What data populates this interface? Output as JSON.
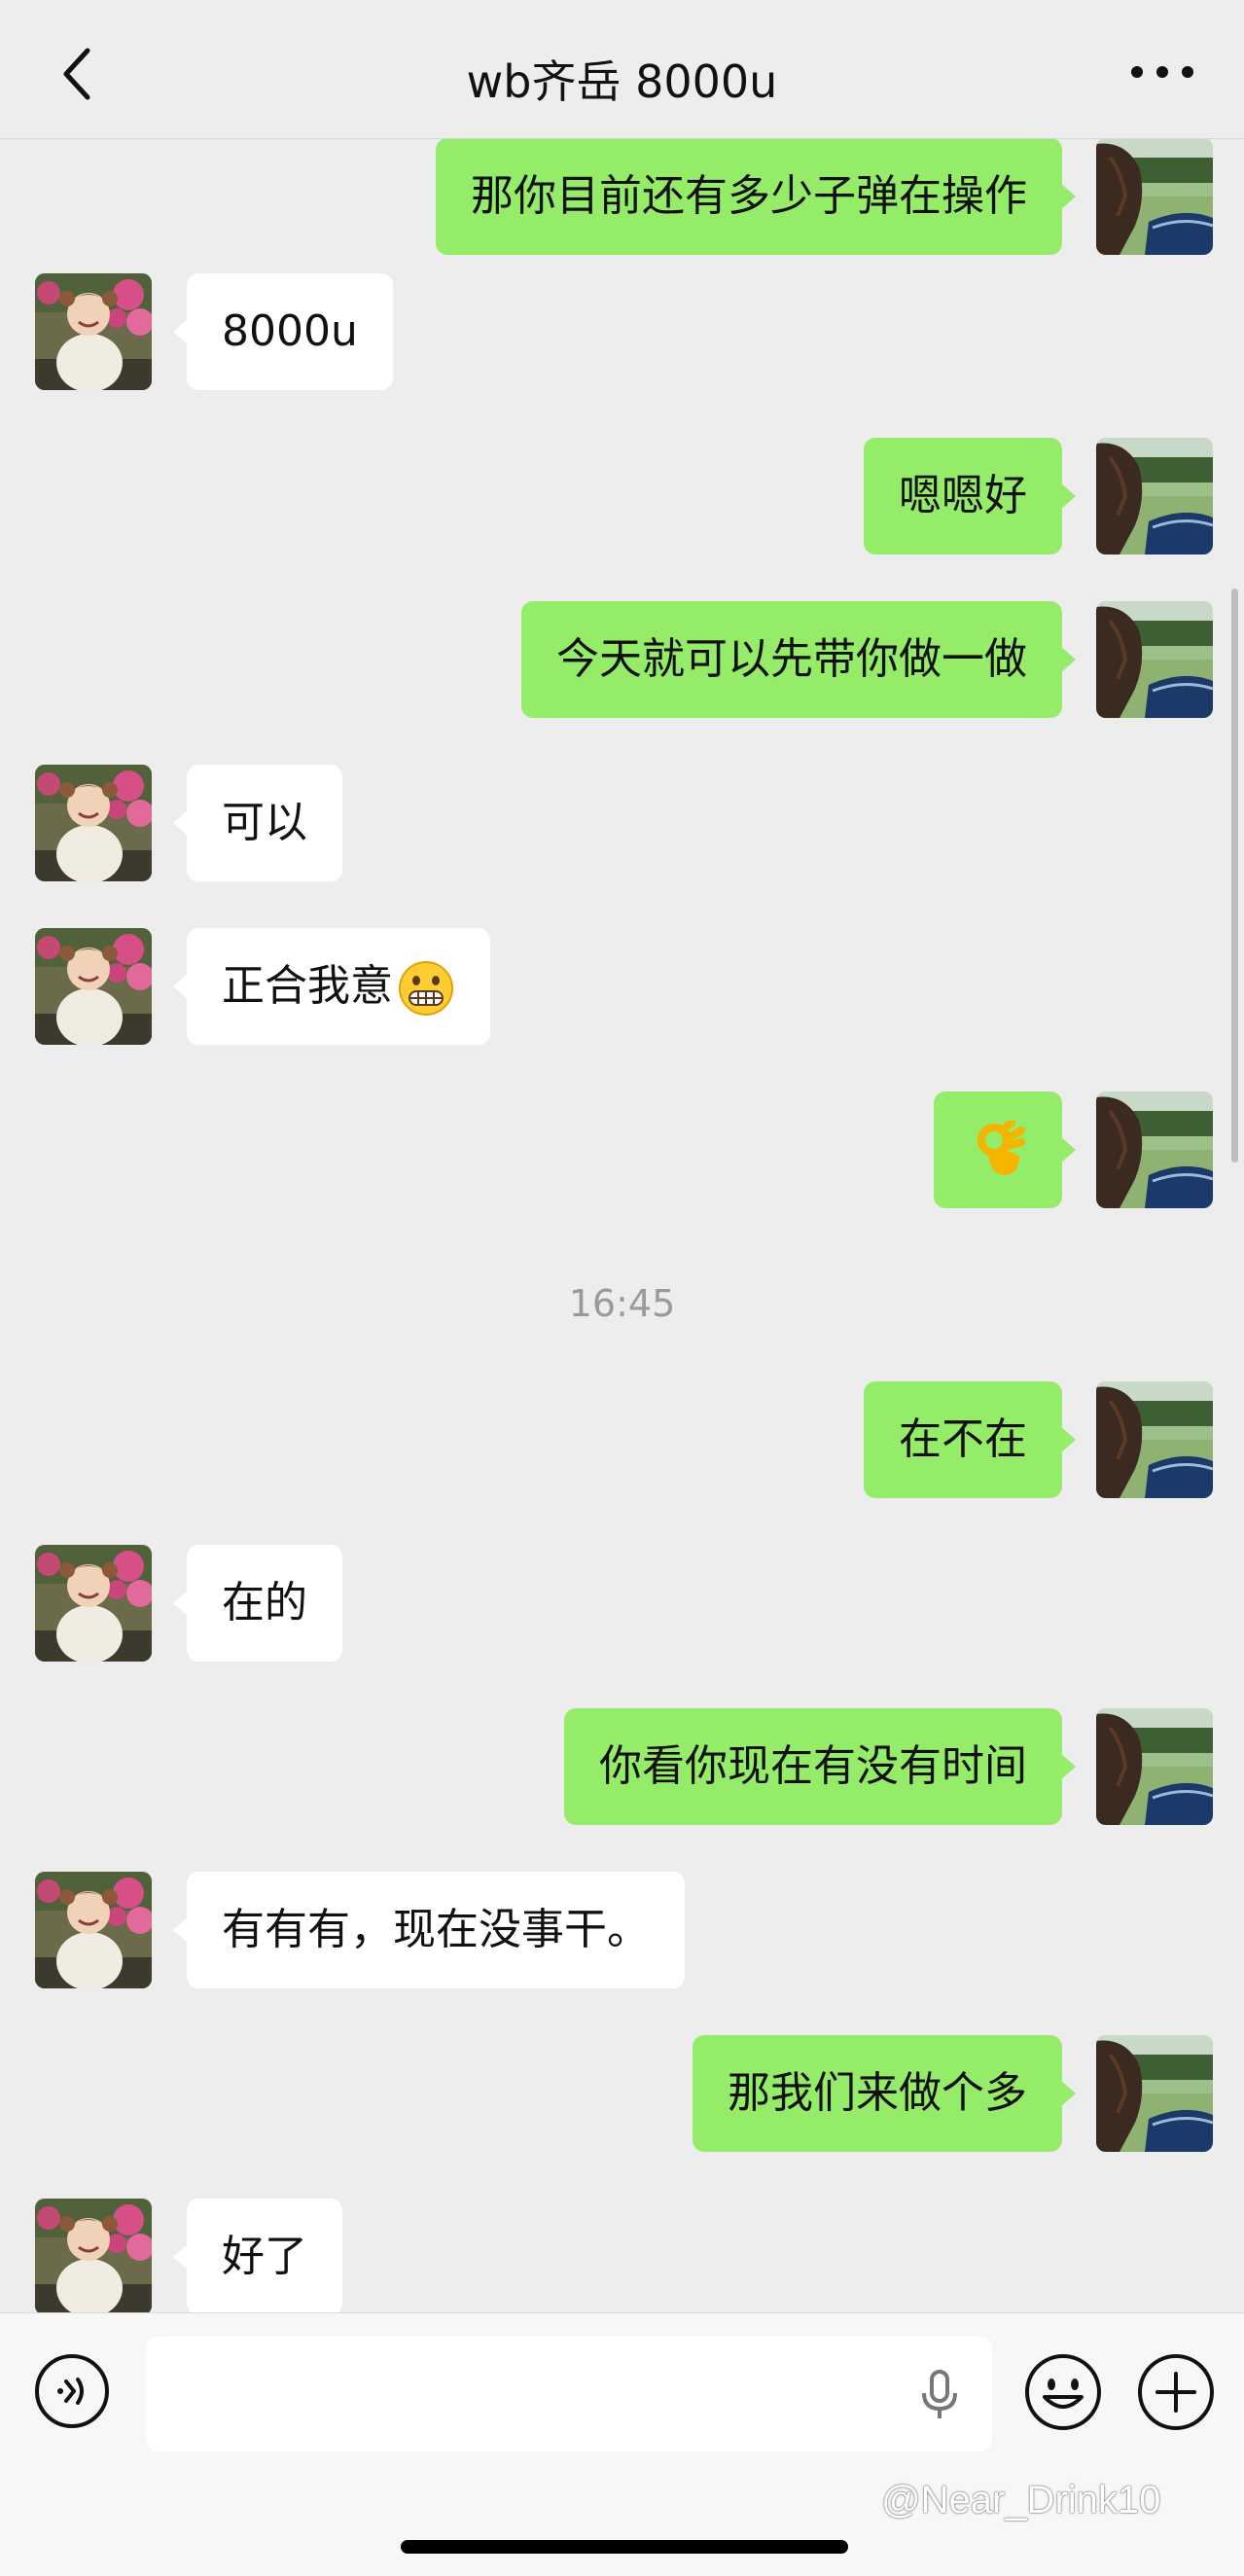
{
  "header": {
    "title": "wb齐岳 8000u"
  },
  "messages": [
    {
      "side": "right",
      "text": "那你目前还有多少子弹在操作"
    },
    {
      "side": "left",
      "text": "8000u"
    },
    {
      "side": "right",
      "text": "嗯嗯好"
    },
    {
      "side": "right",
      "text": "今天就可以先带你做一做"
    },
    {
      "side": "left",
      "text": "可以"
    },
    {
      "side": "left",
      "text": "正合我意",
      "emoji": "grimacing-face"
    },
    {
      "side": "right",
      "text": "👌",
      "emoji": "ok-hand"
    },
    {
      "side": "left",
      "text": "在的"
    },
    {
      "side": "right",
      "text": "在不在"
    },
    {
      "side": "right",
      "text": "你看你现在有没有时间"
    },
    {
      "side": "left",
      "text": "有有有，现在没事干。"
    },
    {
      "side": "right",
      "text": "那我们来做个多"
    },
    {
      "side": "left",
      "text": "好了"
    }
  ],
  "timestamp": "16:45",
  "input": {
    "placeholder": ""
  },
  "watermark": "@Near_Drink10",
  "colors": {
    "background": "#ededed",
    "sent_bubble": "#95ec69",
    "received_bubble": "#ffffff",
    "timestamp": "#9a9a9a"
  },
  "icons": [
    "back-icon",
    "more-icon",
    "voice-icon",
    "microphone-icon",
    "emoji-icon",
    "plus-icon"
  ]
}
